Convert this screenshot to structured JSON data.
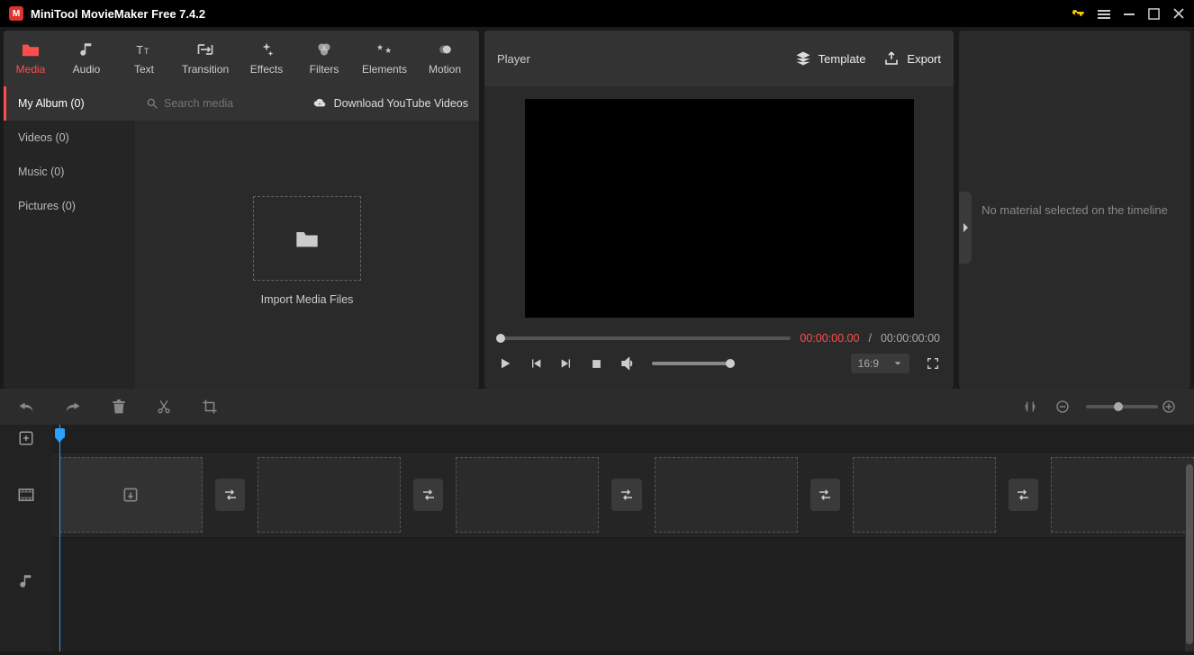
{
  "titlebar": {
    "title": "MiniTool MovieMaker Free 7.4.2"
  },
  "topTabs": {
    "media": "Media",
    "audio": "Audio",
    "text": "Text",
    "transition": "Transition",
    "effects": "Effects",
    "filters": "Filters",
    "elements": "Elements",
    "motion": "Motion"
  },
  "sidebar": {
    "items": [
      {
        "label": "My Album (0)"
      },
      {
        "label": "Videos (0)"
      },
      {
        "label": "Music (0)"
      },
      {
        "label": "Pictures (0)"
      }
    ]
  },
  "mediaToolbar": {
    "searchPlaceholder": "Search media",
    "download": "Download YouTube Videos"
  },
  "importZone": {
    "label": "Import Media Files"
  },
  "player": {
    "title": "Player",
    "template": "Template",
    "export": "Export",
    "timeCurrent": "00:00:00.00",
    "timeSep": "/",
    "timeTotal": "00:00:00:00",
    "aspect": "16:9"
  },
  "rightPanel": {
    "message": "No material selected on the timeline"
  }
}
